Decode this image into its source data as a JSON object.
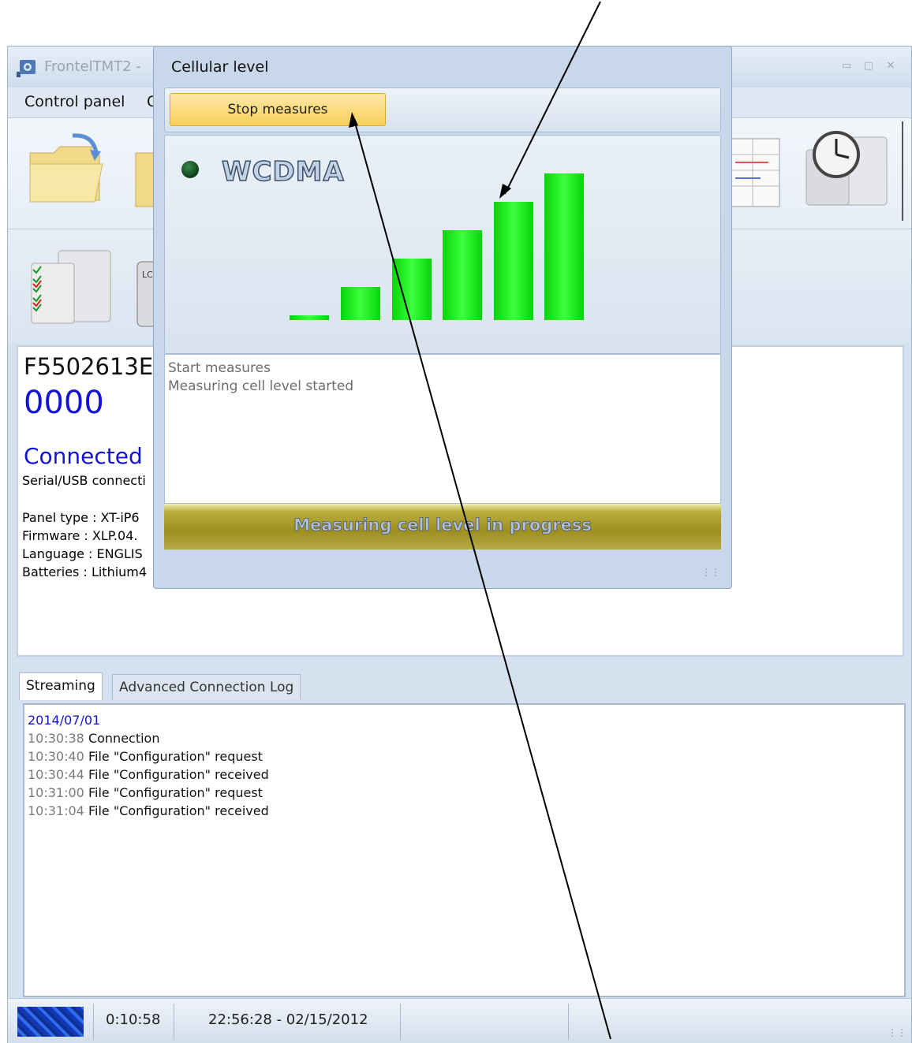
{
  "main_window": {
    "title": "FrontelTMT2 -",
    "menu": [
      "Control panel",
      "C"
    ]
  },
  "info": {
    "serial": "F5502613E",
    "code": "0000",
    "connection_status": "Connected",
    "connection_type": "Serial/USB connecti",
    "panel_type": "Panel type : XT-iP6",
    "firmware": "Firmware : XLP.04.",
    "language": "Language : ENGLIS",
    "batteries": "Batteries : Lithium4"
  },
  "tabs": {
    "streaming": "Streaming",
    "advanced": "Advanced Connection Log"
  },
  "log": {
    "date": "2014/07/01",
    "entries": [
      {
        "time": "10:30:38",
        "msg": "Connection"
      },
      {
        "time": "10:30:40",
        "msg": "File \"Configuration\" request"
      },
      {
        "time": "10:30:44",
        "msg": "File \"Configuration\" received"
      },
      {
        "time": "10:31:00",
        "msg": "File \"Configuration\" request"
      },
      {
        "time": "10:31:04",
        "msg": "File \"Configuration\" received"
      }
    ]
  },
  "status_bar": {
    "elapsed": "0:10:58",
    "datetime": "22:56:28 - 02/15/2012"
  },
  "dialog": {
    "title": "Cellular level",
    "stop_button": "Stop measures",
    "technology": "WCDMA",
    "signal_bars_total": 6,
    "signal_bars_active": 5,
    "messages": [
      "Start measures",
      "Measuring cell level started"
    ],
    "progress_text": "Measuring cell level in progress"
  },
  "colors": {
    "bar_green": "#18f018",
    "accent_blue": "#1313d8",
    "button_yellow": "#f7cf58"
  }
}
